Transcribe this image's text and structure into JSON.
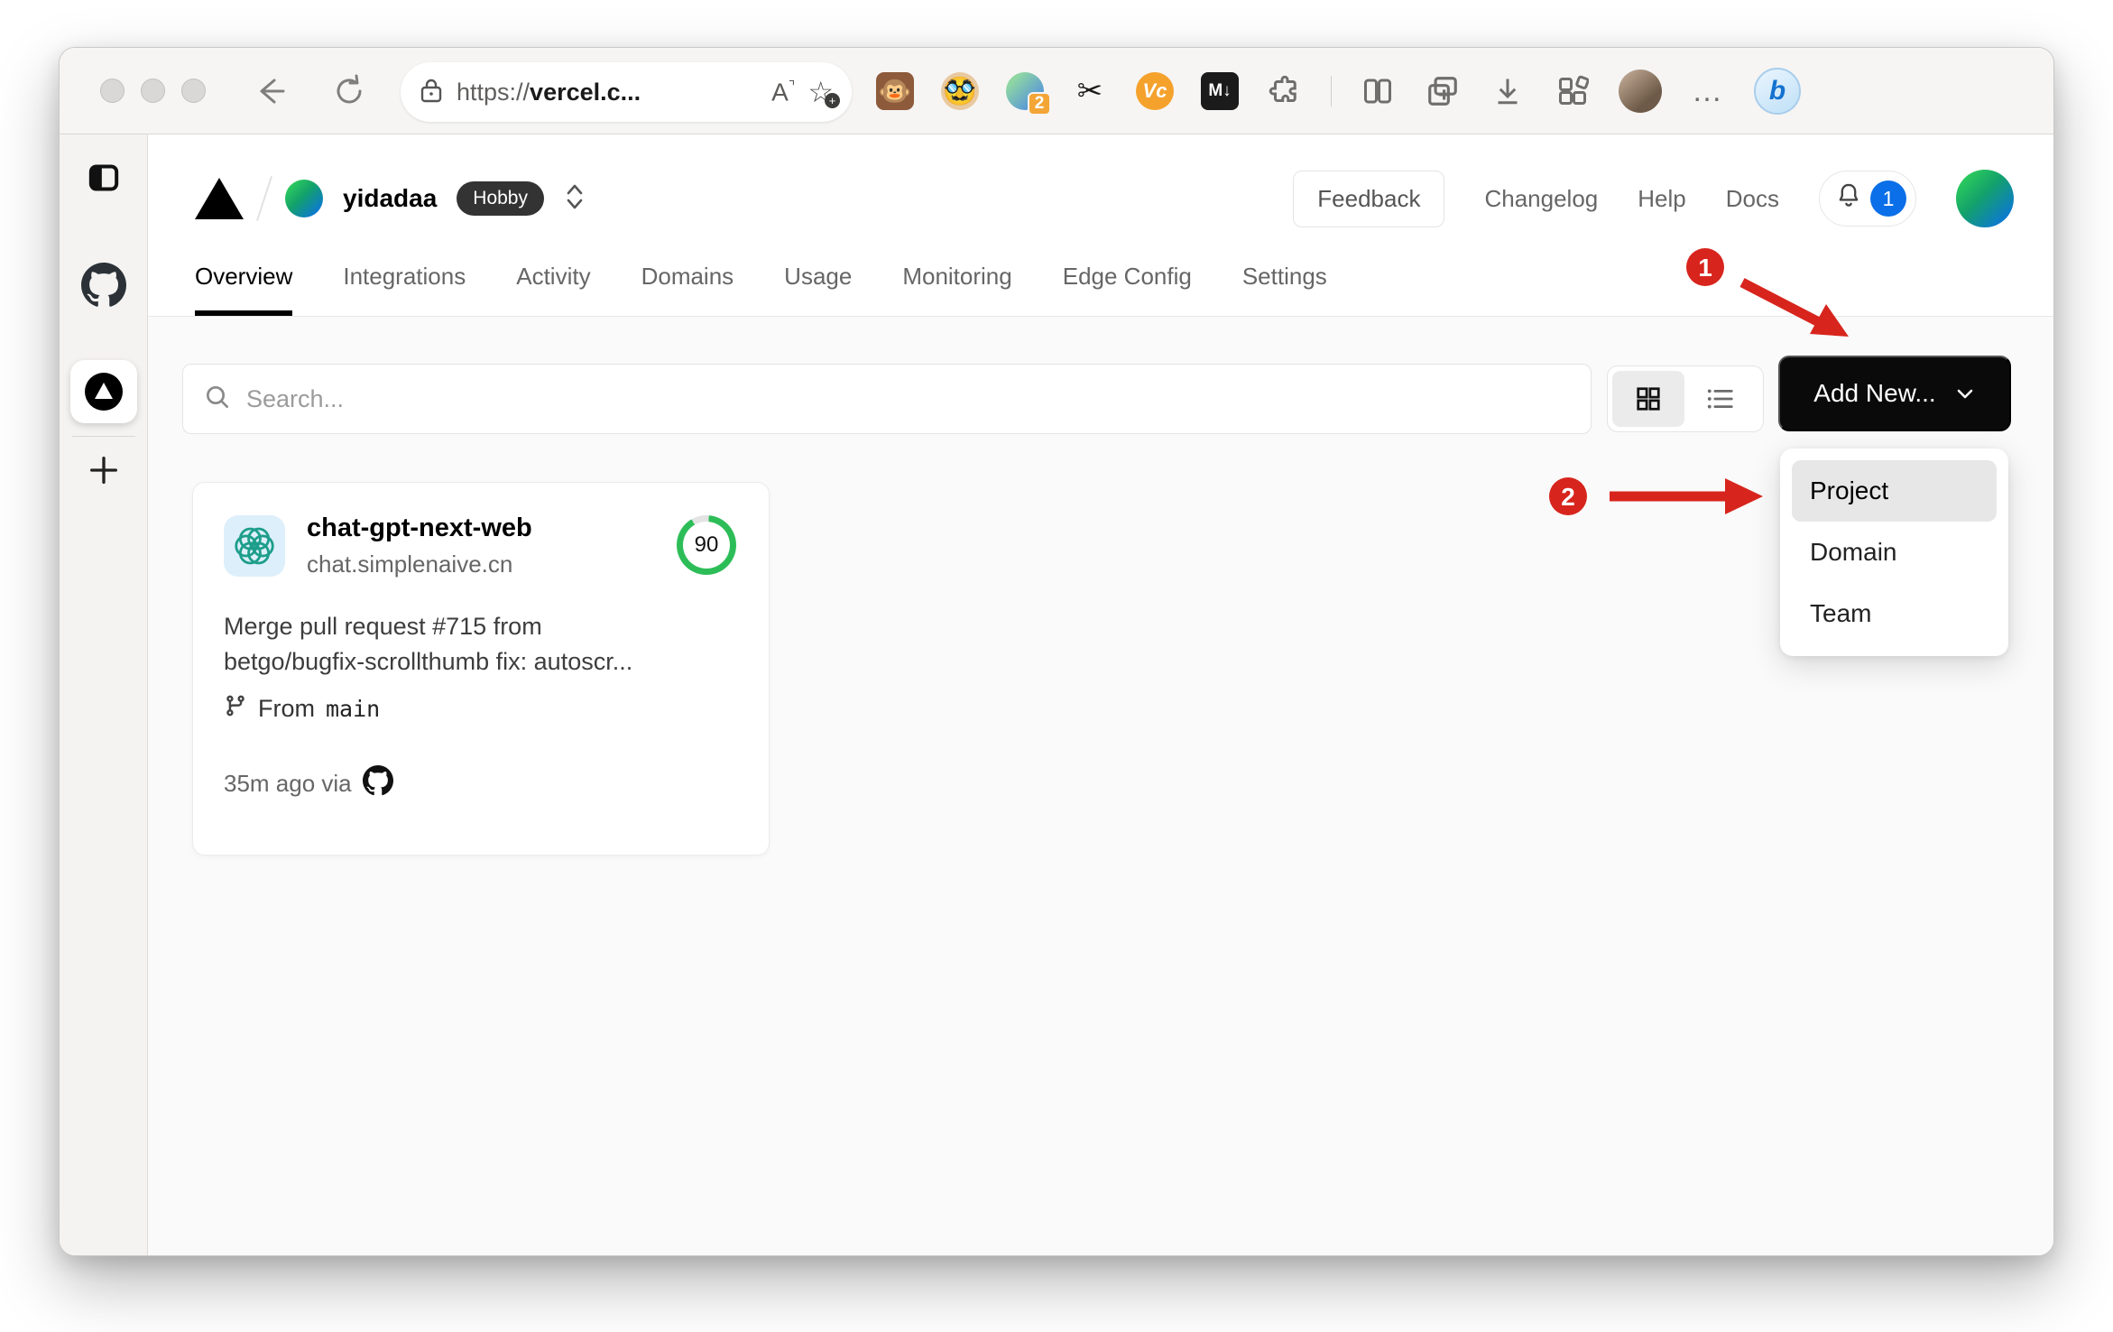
{
  "browser": {
    "url_scheme": "https://",
    "url_host": "vercel.c...",
    "reader_label": "A",
    "extensions": {
      "monkey_glyph": "🐵",
      "face_glyph": "🥸",
      "proxy_badge": "2",
      "scissors_glyph": "✂",
      "vc_label": "Vc",
      "md_label": "M↓",
      "more_label": "…",
      "bing_label": "b"
    }
  },
  "header": {
    "team_name": "yidadaa",
    "plan_badge": "Hobby",
    "feedback_label": "Feedback",
    "links": [
      "Changelog",
      "Help",
      "Docs"
    ],
    "notification_count": "1"
  },
  "nav": {
    "tabs": [
      "Overview",
      "Integrations",
      "Activity",
      "Domains",
      "Usage",
      "Monitoring",
      "Edge Config",
      "Settings"
    ]
  },
  "content": {
    "search_placeholder": "Search...",
    "add_new_label": "Add New...",
    "menu_items": [
      "Project",
      "Domain",
      "Team"
    ],
    "project": {
      "name": "chat-gpt-next-web",
      "domain": "chat.simplenaive.cn",
      "score": "90",
      "commit_line1": "Merge pull request #715 from",
      "commit_line2": "betgo/bugfix-scrollthumb fix: autoscr...",
      "branch_prefix": "From",
      "branch_name": "main",
      "deployed_text": "35m ago via"
    }
  },
  "annotations": {
    "step1": "1",
    "step2": "2"
  },
  "colors": {
    "accent_blue": "#0a6fe8",
    "score_green": "#2dbd58",
    "annotation_red": "#d7251d",
    "badge_dark": "#333333"
  }
}
